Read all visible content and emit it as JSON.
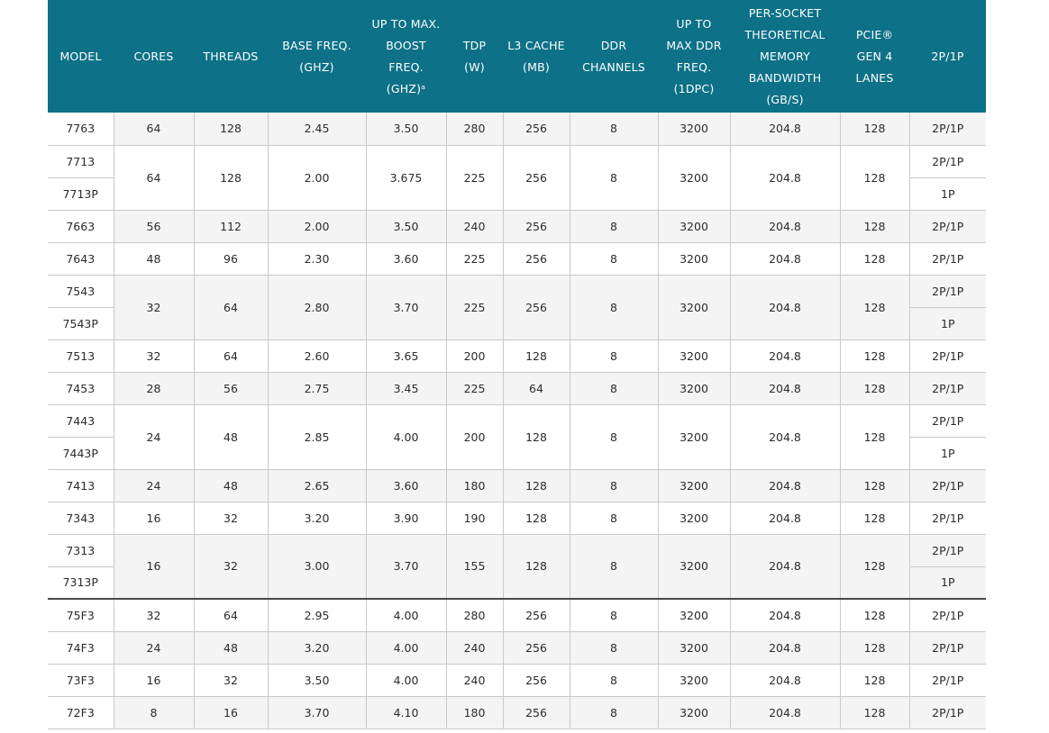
{
  "headers": [
    {
      "key": "model",
      "lines": [
        "MODEL"
      ]
    },
    {
      "key": "cores",
      "lines": [
        "CORES"
      ]
    },
    {
      "key": "threads",
      "lines": [
        "THREADS"
      ]
    },
    {
      "key": "base",
      "lines": [
        "BASE FREQ.",
        "(GHZ)"
      ]
    },
    {
      "key": "boost",
      "lines": [
        "UP TO MAX.",
        "BOOST",
        "FREQ.",
        "(GHZ)ᵃ"
      ]
    },
    {
      "key": "tdp",
      "lines": [
        "TDP",
        "(W)"
      ]
    },
    {
      "key": "l3",
      "lines": [
        "L3 CACHE",
        "(MB)"
      ]
    },
    {
      "key": "ddr",
      "lines": [
        "DDR",
        "CHANNELS"
      ]
    },
    {
      "key": "ddrfreq",
      "lines": [
        "UP TO",
        "MAX DDR",
        "FREQ.",
        "(1DPC)"
      ]
    },
    {
      "key": "bw",
      "lines": [
        "PER-SOCKET",
        "THEORETICAL",
        "MEMORY",
        "BANDWIDTH",
        "(GB/S)"
      ]
    },
    {
      "key": "pcie",
      "lines": [
        "PCIE®",
        "GEN 4",
        "LANES"
      ]
    },
    {
      "key": "sock",
      "lines": [
        "2P/1P"
      ]
    }
  ],
  "groups": [
    {
      "models": [
        {
          "name": "7763",
          "sock": "2P/1P"
        }
      ],
      "cores": "64",
      "threads": "128",
      "base": "2.45",
      "boost": "3.50",
      "tdp": "280",
      "l3": "256",
      "ddr": "8",
      "ddrfreq": "3200",
      "bw": "204.8",
      "pcie": "128"
    },
    {
      "models": [
        {
          "name": "7713",
          "sock": "2P/1P"
        },
        {
          "name": "7713P",
          "sock": "1P"
        }
      ],
      "cores": "64",
      "threads": "128",
      "base": "2.00",
      "boost": "3.675",
      "tdp": "225",
      "l3": "256",
      "ddr": "8",
      "ddrfreq": "3200",
      "bw": "204.8",
      "pcie": "128"
    },
    {
      "models": [
        {
          "name": "7663",
          "sock": "2P/1P"
        }
      ],
      "cores": "56",
      "threads": "112",
      "base": "2.00",
      "boost": "3.50",
      "tdp": "240",
      "l3": "256",
      "ddr": "8",
      "ddrfreq": "3200",
      "bw": "204.8",
      "pcie": "128"
    },
    {
      "models": [
        {
          "name": "7643",
          "sock": "2P/1P"
        }
      ],
      "cores": "48",
      "threads": "96",
      "base": "2.30",
      "boost": "3.60",
      "tdp": "225",
      "l3": "256",
      "ddr": "8",
      "ddrfreq": "3200",
      "bw": "204.8",
      "pcie": "128"
    },
    {
      "models": [
        {
          "name": "7543",
          "sock": "2P/1P"
        },
        {
          "name": "7543P",
          "sock": "1P"
        }
      ],
      "cores": "32",
      "threads": "64",
      "base": "2.80",
      "boost": "3.70",
      "tdp": "225",
      "l3": "256",
      "ddr": "8",
      "ddrfreq": "3200",
      "bw": "204.8",
      "pcie": "128"
    },
    {
      "models": [
        {
          "name": "7513",
          "sock": "2P/1P"
        }
      ],
      "cores": "32",
      "threads": "64",
      "base": "2.60",
      "boost": "3.65",
      "tdp": "200",
      "l3": "128",
      "ddr": "8",
      "ddrfreq": "3200",
      "bw": "204.8",
      "pcie": "128"
    },
    {
      "models": [
        {
          "name": "7453",
          "sock": "2P/1P"
        }
      ],
      "cores": "28",
      "threads": "56",
      "base": "2.75",
      "boost": "3.45",
      "tdp": "225",
      "l3": "64",
      "ddr": "8",
      "ddrfreq": "3200",
      "bw": "204.8",
      "pcie": "128"
    },
    {
      "models": [
        {
          "name": "7443",
          "sock": "2P/1P"
        },
        {
          "name": "7443P",
          "sock": "1P"
        }
      ],
      "cores": "24",
      "threads": "48",
      "base": "2.85",
      "boost": "4.00",
      "tdp": "200",
      "l3": "128",
      "ddr": "8",
      "ddrfreq": "3200",
      "bw": "204.8",
      "pcie": "128"
    },
    {
      "models": [
        {
          "name": "7413",
          "sock": "2P/1P"
        }
      ],
      "cores": "24",
      "threads": "48",
      "base": "2.65",
      "boost": "3.60",
      "tdp": "180",
      "l3": "128",
      "ddr": "8",
      "ddrfreq": "3200",
      "bw": "204.8",
      "pcie": "128"
    },
    {
      "models": [
        {
          "name": "7343",
          "sock": "2P/1P"
        }
      ],
      "cores": "16",
      "threads": "32",
      "base": "3.20",
      "boost": "3.90",
      "tdp": "190",
      "l3": "128",
      "ddr": "8",
      "ddrfreq": "3200",
      "bw": "204.8",
      "pcie": "128"
    },
    {
      "models": [
        {
          "name": "7313",
          "sock": "2P/1P"
        },
        {
          "name": "7313P",
          "sock": "1P"
        }
      ],
      "cores": "16",
      "threads": "32",
      "base": "3.00",
      "boost": "3.70",
      "tdp": "155",
      "l3": "128",
      "ddr": "8",
      "ddrfreq": "3200",
      "bw": "204.8",
      "pcie": "128"
    },
    {
      "models": [
        {
          "name": "75F3",
          "sock": "2P/1P"
        }
      ],
      "cores": "32",
      "threads": "64",
      "base": "2.95",
      "boost": "4.00",
      "tdp": "280",
      "l3": "256",
      "ddr": "8",
      "ddrfreq": "3200",
      "bw": "204.8",
      "pcie": "128",
      "separator": true
    },
    {
      "models": [
        {
          "name": "74F3",
          "sock": "2P/1P"
        }
      ],
      "cores": "24",
      "threads": "48",
      "base": "3.20",
      "boost": "4.00",
      "tdp": "240",
      "l3": "256",
      "ddr": "8",
      "ddrfreq": "3200",
      "bw": "204.8",
      "pcie": "128"
    },
    {
      "models": [
        {
          "name": "73F3",
          "sock": "2P/1P"
        }
      ],
      "cores": "16",
      "threads": "32",
      "base": "3.50",
      "boost": "4.00",
      "tdp": "240",
      "l3": "256",
      "ddr": "8",
      "ddrfreq": "3200",
      "bw": "204.8",
      "pcie": "128"
    },
    {
      "models": [
        {
          "name": "72F3",
          "sock": "2P/1P"
        }
      ],
      "cores": "8",
      "threads": "16",
      "base": "3.70",
      "boost": "4.10",
      "tdp": "180",
      "l3": "256",
      "ddr": "8",
      "ddrfreq": "3200",
      "bw": "204.8",
      "pcie": "128"
    }
  ],
  "colors": {
    "header_bg": "#0d7187",
    "header_text": "#ffffff",
    "row_shade": "#f4f4f4"
  }
}
